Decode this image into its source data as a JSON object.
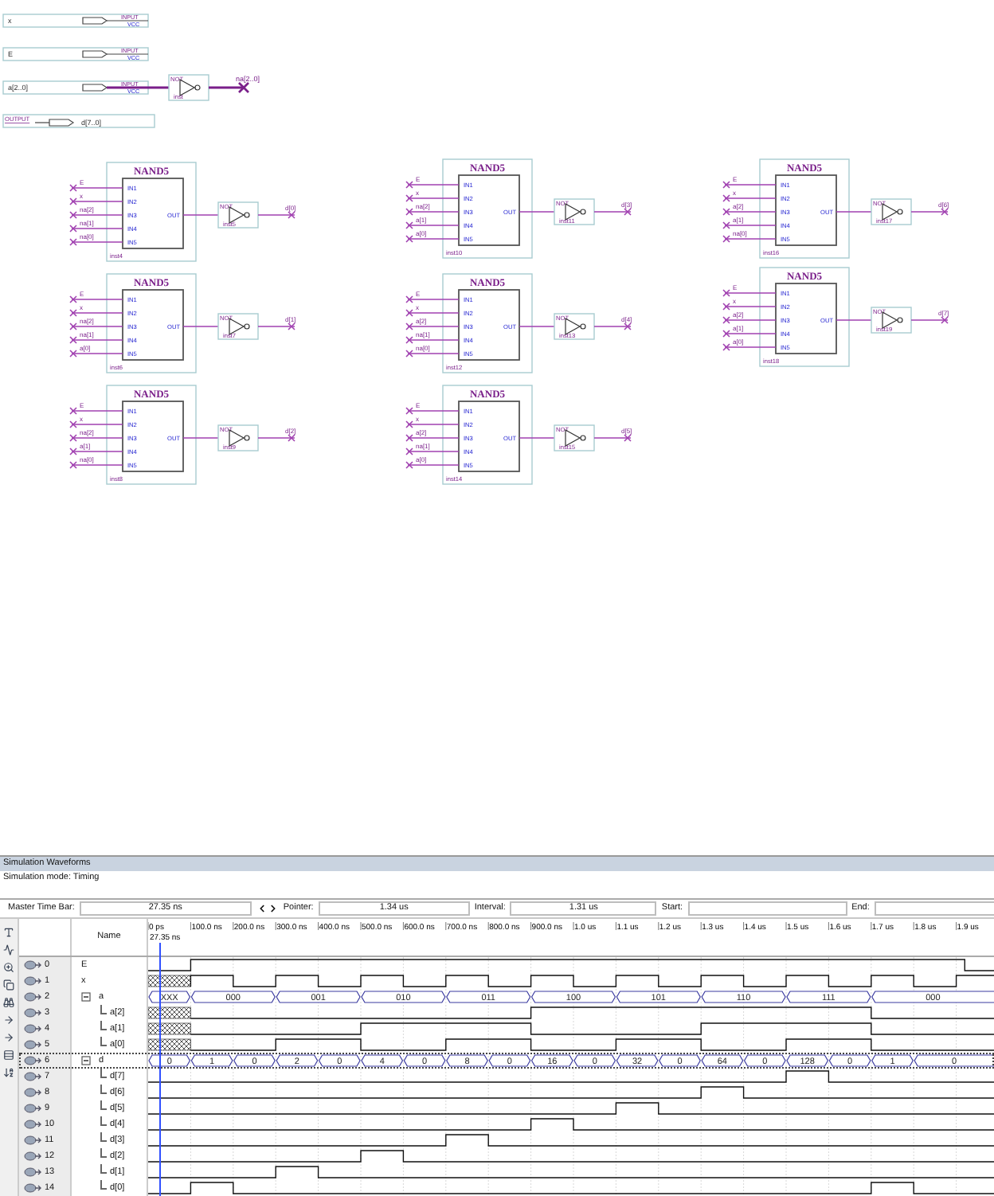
{
  "schematic": {
    "input_pins": [
      {
        "name": "x",
        "type": "INPUT",
        "default": "VCC"
      },
      {
        "name": "E",
        "type": "INPUT",
        "default": "VCC"
      },
      {
        "name": "a[2..0]",
        "type": "INPUT",
        "default": "VCC"
      }
    ],
    "inverter": {
      "type": "NOT",
      "instance": "inst",
      "output": "na[2..0]"
    },
    "output_pin": {
      "type": "OUTPUT",
      "name": "d[7..0]"
    },
    "blocks": [
      {
        "title": "NAND5",
        "inputs": [
          "E",
          "x",
          "na[2]",
          "na[1]",
          "na[0]"
        ],
        "ports": [
          "IN1",
          "IN2",
          "IN3",
          "IN4",
          "IN5"
        ],
        "out_port": "OUT",
        "instance": "inst4",
        "not_type": "NOT",
        "not_instance": "inst5",
        "output": "d[0]"
      },
      {
        "title": "NAND5",
        "inputs": [
          "E",
          "x",
          "na[2]",
          "na[1]",
          "a[0]"
        ],
        "ports": [
          "IN1",
          "IN2",
          "IN3",
          "IN4",
          "IN5"
        ],
        "out_port": "OUT",
        "instance": "inst6",
        "not_type": "NOT",
        "not_instance": "inst7",
        "output": "d[1]"
      },
      {
        "title": "NAND5",
        "inputs": [
          "E",
          "x",
          "na[2]",
          "a[1]",
          "na[0]"
        ],
        "ports": [
          "IN1",
          "IN2",
          "IN3",
          "IN4",
          "IN5"
        ],
        "out_port": "OUT",
        "instance": "inst8",
        "not_type": "NOT",
        "not_instance": "inst9",
        "output": "d[2]"
      },
      {
        "title": "NAND5",
        "inputs": [
          "E",
          "x",
          "na[2]",
          "a[1]",
          "a[0]"
        ],
        "ports": [
          "IN1",
          "IN2",
          "IN3",
          "IN4",
          "IN5"
        ],
        "out_port": "OUT",
        "instance": "inst10",
        "not_type": "NOT",
        "not_instance": "inst11",
        "output": "d[3]"
      },
      {
        "title": "NAND5",
        "inputs": [
          "E",
          "x",
          "a[2]",
          "na[1]",
          "na[0]"
        ],
        "ports": [
          "IN1",
          "IN2",
          "IN3",
          "IN4",
          "IN5"
        ],
        "out_port": "OUT",
        "instance": "inst12",
        "not_type": "NOT",
        "not_instance": "inst13",
        "output": "d[4]"
      },
      {
        "title": "NAND5",
        "inputs": [
          "E",
          "x",
          "a[2]",
          "na[1]",
          "a[0]"
        ],
        "ports": [
          "IN1",
          "IN2",
          "IN3",
          "IN4",
          "IN5"
        ],
        "out_port": "OUT",
        "instance": "inst14",
        "not_type": "NOT",
        "not_instance": "inst15",
        "output": "d[5]"
      },
      {
        "title": "NAND5",
        "inputs": [
          "E",
          "x",
          "a[2]",
          "a[1]",
          "na[0]"
        ],
        "ports": [
          "IN1",
          "IN2",
          "IN3",
          "IN4",
          "IN5"
        ],
        "out_port": "OUT",
        "instance": "inst16",
        "not_type": "NOT",
        "not_instance": "inst17",
        "output": "d[6]"
      },
      {
        "title": "NAND5",
        "inputs": [
          "E",
          "x",
          "a[2]",
          "a[1]",
          "a[0]"
        ],
        "ports": [
          "IN1",
          "IN2",
          "IN3",
          "IN4",
          "IN5"
        ],
        "out_port": "OUT",
        "instance": "inst18",
        "not_type": "NOT",
        "not_instance": "inst19",
        "output": "d[7]"
      }
    ]
  },
  "waveform": {
    "title": "Simulation Waveforms",
    "mode": "Simulation mode: Timing",
    "fields": [
      {
        "label": "Master Time Bar:",
        "value": "27.35 ns",
        "kind": "spin"
      },
      {
        "label": "Pointer:",
        "value": "1.34 us",
        "kind": "plain"
      },
      {
        "label": "Interval:",
        "value": "1.31 us",
        "kind": "plain"
      },
      {
        "label": "Start:",
        "kind": "plain"
      },
      {
        "label": "End:",
        "kind": "plain"
      }
    ],
    "name_header": "Name",
    "ruler": [
      "0 ps",
      "100.0 ns",
      "200.0 ns",
      "300.0 ns",
      "400.0 ns",
      "500.0 ns",
      "600.0 ns",
      "700.0 ns",
      "800.0 ns",
      "900.0 ns",
      "1.0 us",
      "1.1 us",
      "1.2 us",
      "1.3 us",
      "1.4 us",
      "1.5 us",
      "1.6 us",
      "1.7 us",
      "1.8 us",
      "1.9 us"
    ],
    "cursor_label": "27.35 ns",
    "rows": [
      {
        "index": "0",
        "name": "E",
        "kind": "bit",
        "selected": false
      },
      {
        "index": "1",
        "name": "x",
        "kind": "bit",
        "selected": false
      },
      {
        "index": "2",
        "name": "a",
        "kind": "bus",
        "expanded": true,
        "selected": false,
        "values": [
          "XXX",
          "000",
          "001",
          "010",
          "011",
          "100",
          "101",
          "110",
          "111",
          "000"
        ],
        "children": [
          {
            "index": "3",
            "name": "a[2]",
            "kind": "bit",
            "selected": false
          },
          {
            "index": "4",
            "name": "a[1]",
            "kind": "bit",
            "selected": false
          },
          {
            "index": "5",
            "name": "a[0]",
            "kind": "bit",
            "selected": false
          }
        ]
      },
      {
        "index": "6",
        "name": "d",
        "kind": "bus",
        "expanded": true,
        "selected": true,
        "values": [
          "0",
          "1",
          "0",
          "2",
          "0",
          "4",
          "0",
          "8",
          "0",
          "16",
          "0",
          "32",
          "0",
          "64",
          "0",
          "128",
          "0",
          "1",
          "0"
        ],
        "children": [
          {
            "index": "7",
            "name": "d[7]",
            "kind": "bit",
            "selected": false
          },
          {
            "index": "8",
            "name": "d[6]",
            "kind": "bit",
            "selected": false
          },
          {
            "index": "9",
            "name": "d[5]",
            "kind": "bit",
            "selected": false
          },
          {
            "index": "10",
            "name": "d[4]",
            "kind": "bit",
            "selected": false
          },
          {
            "index": "11",
            "name": "d[3]",
            "kind": "bit",
            "selected": false
          },
          {
            "index": "12",
            "name": "d[2]",
            "kind": "bit",
            "selected": false
          },
          {
            "index": "13",
            "name": "d[1]",
            "kind": "bit",
            "selected": false
          },
          {
            "index": "14",
            "name": "d[0]",
            "kind": "bit",
            "selected": false
          }
        ]
      }
    ]
  }
}
